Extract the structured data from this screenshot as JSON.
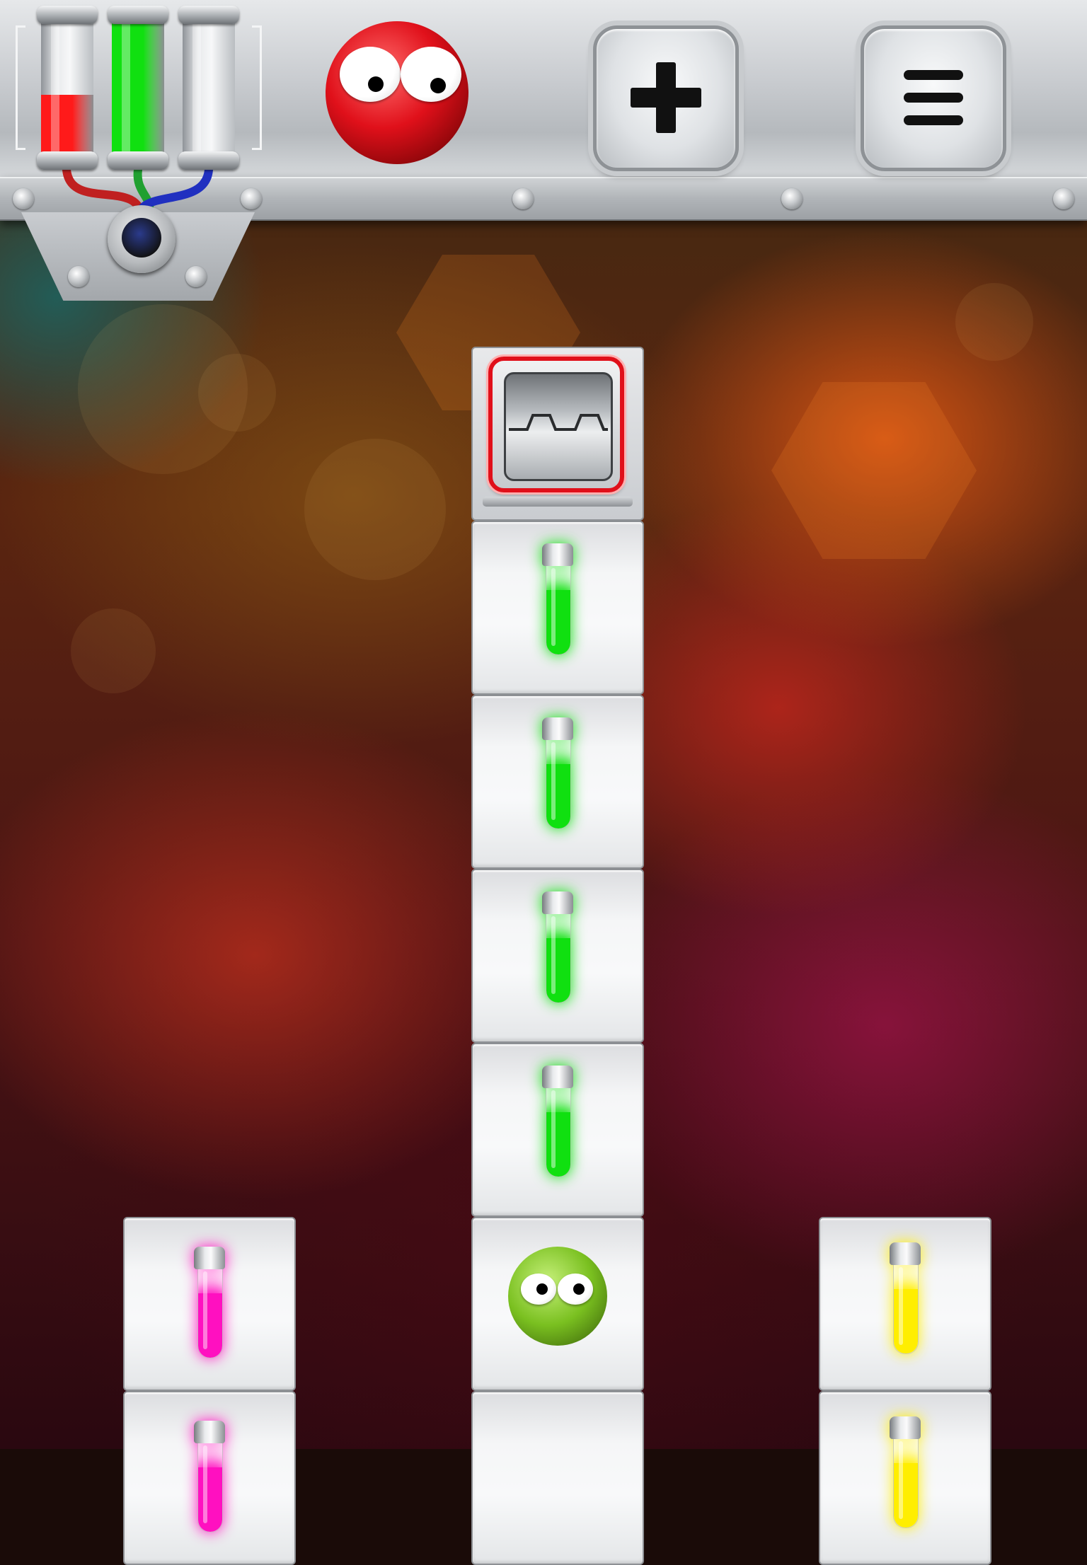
{
  "hud": {
    "meters": [
      {
        "name": "red-meter",
        "level": 0.47,
        "color": "#ff1a1a"
      },
      {
        "name": "green-meter",
        "level": 1.0,
        "color": "#10e010"
      },
      {
        "name": "blue-meter",
        "level": 0.0,
        "color": "#1a3cff"
      }
    ],
    "player_color": "#e0101a",
    "buttons": [
      {
        "name": "add-button",
        "icon": "plus-icon"
      },
      {
        "name": "menu-button",
        "icon": "hamburger-menu-icon"
      }
    ]
  },
  "board": {
    "column_center": {
      "exit": {
        "icon": "exit-door-icon",
        "frame_color": "#e0101a"
      },
      "vials": [
        "#10e010",
        "#10e010",
        "#10e010",
        "#10e010"
      ],
      "character": {
        "color": "#7ac020"
      }
    },
    "column_left": {
      "vials": [
        "#ff10c0",
        "#ff10c0"
      ]
    },
    "column_right": {
      "vials": [
        "#ffee00",
        "#ffee00"
      ]
    }
  }
}
